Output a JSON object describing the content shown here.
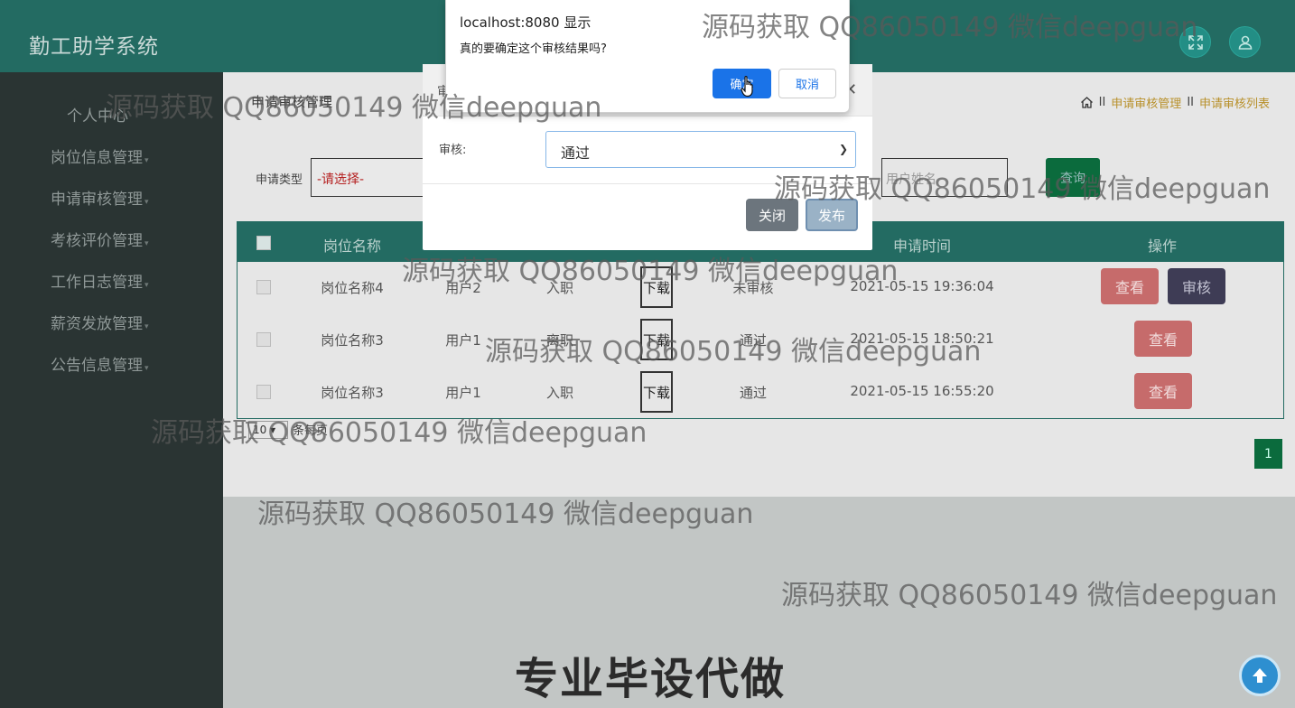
{
  "app": {
    "title": "勤工助学系统"
  },
  "header": {
    "fullscreen_icon": "fullscreen-icon",
    "user_icon": "user-icon"
  },
  "sidebar": {
    "items": [
      {
        "label": "个人中心"
      },
      {
        "label": "岗位信息管理"
      },
      {
        "label": "申请审核管理"
      },
      {
        "label": "考核评价管理"
      },
      {
        "label": "工作日志管理"
      },
      {
        "label": "薪资发放管理"
      },
      {
        "label": "公告信息管理"
      }
    ]
  },
  "page": {
    "title": "申请审核管理",
    "breadcrumb": [
      "申请审核管理",
      "申请审核列表"
    ],
    "breadcrumb_home_icon": "home-icon"
  },
  "filters": {
    "type_label": "申请类型",
    "type_value": "-请选择-",
    "user_placeholder": "用户姓名",
    "query_label": "查询"
  },
  "table": {
    "headers": [
      "岗位名称",
      "申请时间",
      "操作"
    ],
    "rows": [
      {
        "post": "岗位名称4",
        "user": "用户2",
        "type": "入职",
        "download": "下载",
        "status": "未审核",
        "time": "2021-05-15 19:36:04",
        "actions": [
          "查看",
          "审核"
        ]
      },
      {
        "post": "岗位名称3",
        "user": "用户1",
        "type": "离职",
        "download": "下载",
        "status": "通过",
        "time": "2021-05-15 18:50:21",
        "actions": [
          "查看"
        ]
      },
      {
        "post": "岗位名称3",
        "user": "用户1",
        "type": "入职",
        "download": "下载",
        "status": "通过",
        "time": "2021-05-15 16:55:20",
        "actions": [
          "查看"
        ]
      }
    ]
  },
  "pagination": {
    "page_size": "10",
    "page_size_label": "条每页",
    "current_page": "1"
  },
  "modal": {
    "head_fragment": "审",
    "field_label": "审核:",
    "field_value": "通过",
    "close_label": "关闭",
    "publish_label": "发布"
  },
  "confirm": {
    "origin": "localhost:8080 显示",
    "message": "真的要确定这个审核结果吗?",
    "ok_label": "确定",
    "cancel_label": "取消"
  },
  "watermark": "源码获取 QQ86050149 微信deepguan",
  "promo": "专业毕设代做",
  "colors": {
    "header_bg": "#236b62",
    "sidebar_bg": "#2a3433",
    "accent_green": "#0b6b3d",
    "danger": "#c66b6b",
    "confirm_blue": "#1a73e8"
  }
}
